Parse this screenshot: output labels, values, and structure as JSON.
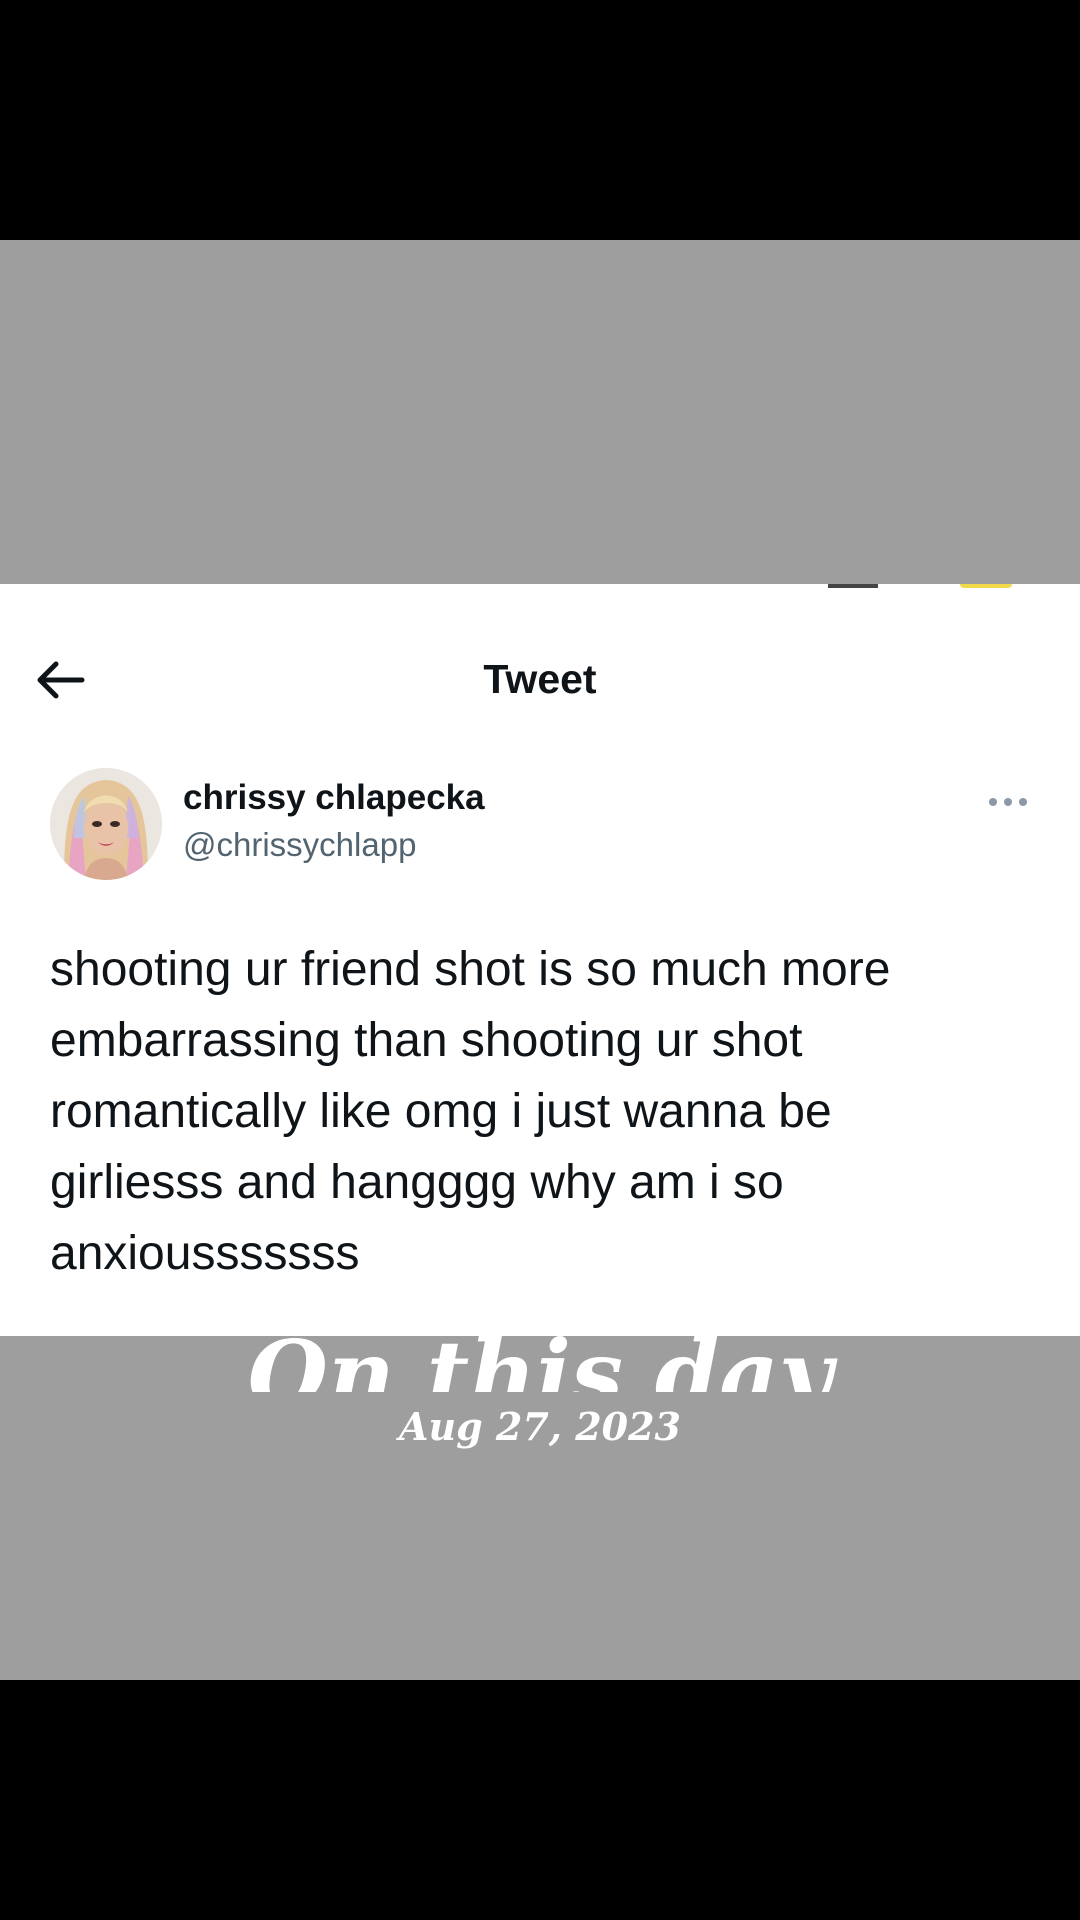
{
  "tweet_screen": {
    "header_title": "Tweet",
    "author": {
      "display_name": "chrissy chlapecka",
      "handle": "@chrissychlapp"
    },
    "body": "shooting ur friend shot is so much more\nembarrassing than shooting ur shot\nromantically like omg i just wanna be\ngirliesss and hangggg why am i so\nanxiousssssss"
  },
  "overlay": {
    "title": "On this day",
    "date": "Aug 27, 2023"
  },
  "icons": {
    "back": "arrow-left-icon",
    "more": "more-horizontal-icon",
    "avatar": "profile-photo"
  },
  "colors": {
    "band_gray": "#9e9e9e",
    "text_primary": "#0f1419",
    "text_secondary": "#536471"
  }
}
